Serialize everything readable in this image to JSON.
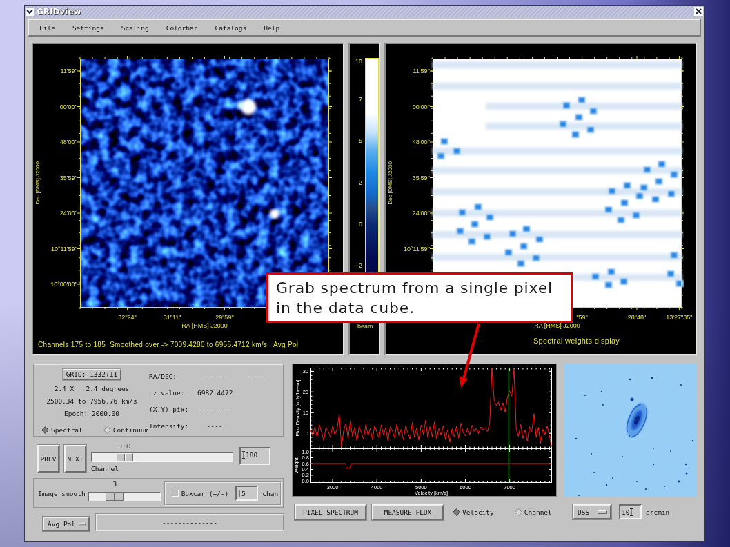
{
  "window": {
    "title": "GRIDview"
  },
  "menu": [
    "File",
    "Settings",
    "Scaling",
    "Colorbar",
    "Catalogs",
    "Help"
  ],
  "map_panel": {
    "dec_axis_title": "Dec [DMS] J2000",
    "dec_ticks": [
      "11'59''",
      "00'00''",
      "48'00''",
      "35'59''",
      "24'00''",
      "10°11'59''",
      "10°00'00''"
    ],
    "ra_ticks": [
      "32\"24\"",
      "31\"11\"",
      "29\"59\""
    ],
    "ra_axis_title": "RA [HMS] J2000",
    "caption": "Channels 175 to 185  Smoothed over -> 7009.4280 to 6955.4712 km/s   Avg Pol"
  },
  "colorbar": {
    "ticks": [
      "10",
      "7",
      "5",
      "2",
      "0",
      "−2"
    ],
    "unit": "beam"
  },
  "weights_panel": {
    "dec_axis_title": "Dec [DMS] J2000",
    "dec_ticks": [
      "11'59''",
      "00'00''",
      "48'00''",
      "35'59''",
      "24'00''",
      "10°11'59''"
    ],
    "ra_ticks": [
      "\"59\"",
      "28\"48\"",
      "13'27\"35\""
    ],
    "ra_axis_title": "RA [HMS] J2000",
    "caption": "Spectral weights display"
  },
  "callout": {
    "text": "Grab spectrum from a single pixel in the data cube."
  },
  "info": {
    "grid_label": "GRID: 1332+11",
    "size": "2.4 X   2.4 degrees",
    "velocity_range": "2500.34 to 7956.76 km/s",
    "epoch": "Epoch: 2000.00",
    "modes": [
      {
        "label": "Spectral",
        "selected": true
      },
      {
        "label": "Continuum",
        "selected": false
      }
    ],
    "readouts": [
      {
        "label": "RA/DEC:",
        "values": [
          "----",
          "----"
        ]
      },
      {
        "label": "cz value:",
        "values": [
          "6982.4472"
        ]
      },
      {
        "label": "(X,Y) pix:",
        "values": [
          "--------"
        ]
      },
      {
        "label": "Intensity:",
        "values": [
          "----"
        ]
      }
    ]
  },
  "channel": {
    "prev": "PREV",
    "next": "NEXT",
    "value_label": "180",
    "level": 0.2,
    "caption": "Channel",
    "input_value": "180"
  },
  "smooth": {
    "label": "Image smooth",
    "value_label": "3",
    "level": 0.32,
    "boxcar": {
      "label": "Boxcar (+/-)",
      "checked": false,
      "value": "5",
      "unit": "chan"
    }
  },
  "polarization": {
    "selection": "Avg Pol",
    "status": "--------------"
  },
  "spectrum": {
    "flux_chart": {
      "chart_data": {
        "type": "line",
        "ylabel": "Flux Density [mJy/beam]",
        "x": [
          2500,
          2550,
          2600,
          2650,
          2700,
          2750,
          2800,
          2850,
          2900,
          2950,
          3000,
          3050,
          3100,
          3150,
          3200,
          3250,
          3300,
          3350,
          3400,
          3450,
          3500,
          3550,
          3600,
          3650,
          3700,
          3750,
          3800,
          3850,
          3900,
          3950,
          4000,
          4050,
          4100,
          4150,
          4200,
          4250,
          4300,
          4350,
          4400,
          4450,
          4500,
          4550,
          4600,
          4650,
          4700,
          4750,
          4800,
          4850,
          4900,
          4950,
          5000,
          5050,
          5100,
          5150,
          5200,
          5250,
          5300,
          5350,
          5400,
          5450,
          5500,
          5550,
          5600,
          5650,
          5700,
          5750,
          5800,
          5850,
          5900,
          5950,
          6000,
          6050,
          6100,
          6150,
          6200,
          6250,
          6300,
          6350,
          6400,
          6450,
          6500,
          6550,
          6600,
          6650,
          6700,
          6750,
          6800,
          6850,
          6900,
          6950,
          7000,
          7050,
          7100,
          7150,
          7200,
          7250,
          7300,
          7350,
          7400,
          7450,
          7500,
          7550,
          7600,
          7650,
          7700,
          7750,
          7800,
          7850,
          7900,
          7950
        ],
        "series": [
          {
            "color": "#ff1a1a",
            "values": [
              1.5,
              -1.2,
              3.1,
              -2.0,
              4.2,
              0.5,
              -3.5,
              2.8,
              1.0,
              -1.8,
              3.6,
              -0.7,
              2.2,
              9.2,
              -6.5,
              1.4,
              4.8,
              -2.6,
              5.9,
              -1.5,
              2.9,
              -3.8,
              3.3,
              0.2,
              -2.9,
              4.5,
              -1.1,
              2.4,
              -3.2,
              3.8,
              0.6,
              -2.4,
              4.1,
              -0.9,
              2.7,
              -3.6,
              3.0,
              1.2,
              -2.2,
              4.6,
              -1.4,
              2.0,
              -3.0,
              3.5,
              0.3,
              -2.8,
              5.2,
              -1.9,
              2.6,
              -3.4,
              4.0,
              -0.5,
              6.2,
              -2.1,
              3.2,
              -1.6,
              5.5,
              -2.7,
              2.3,
              -0.8,
              3.7,
              -3.1,
              1.8,
              -4.3,
              2.1,
              -1.7,
              3.4,
              -2.3,
              4.9,
              0.4,
              -1.3,
              2.5,
              -0.6,
              3.9,
              0.9,
              2.4,
              -0.2,
              3.1,
              1.6,
              2.8,
              0.7,
              5.0,
              31.5,
              16.0,
              13.5,
              15.2,
              11.0,
              14.8,
              10.2,
              17.5,
              20.5,
              18.0,
              31.0,
              2.0,
              -1.5,
              4.3,
              -2.5,
              1.7,
              -3.9,
              3.2,
              0.8,
              9.5,
              -2.0,
              2.9,
              -4.8,
              1.9,
              -0.6,
              3.6,
              -1.2,
              -6.5
            ]
          }
        ],
        "xlim": [
          2500,
          7957
        ],
        "ylim": [
          -7.3,
          31.8
        ],
        "yticks": [
          0,
          10,
          20,
          30
        ],
        "ref_lines": [
          {
            "axis": "x",
            "value": 6982,
            "color": "#10c010"
          }
        ]
      }
    },
    "weight_chart": {
      "chart_data": {
        "type": "line",
        "xlabel": "Velocity [km/s]",
        "ylabel": "Weight",
        "x": [
          2500,
          3300,
          3310,
          3400,
          3410,
          7950
        ],
        "series": [
          {
            "color": "#ff1a1a",
            "values": [
              0.6,
              0.6,
              0.45,
              0.45,
              0.6,
              0.6
            ]
          }
        ],
        "xlim": [
          2500,
          7957
        ],
        "ylim": [
          -0.06,
          1.12
        ],
        "xticks": [
          3000,
          4000,
          5000,
          6000,
          7000
        ],
        "yticks": [
          {
            "value": 0,
            "label": "0.0"
          },
          {
            "value": 0.2,
            "label": "0.2"
          },
          {
            "value": 0.4,
            "label": "0.4"
          },
          {
            "value": 0.6,
            "label": "0.6"
          },
          {
            "value": 0.8,
            "label": "0.8"
          },
          {
            "value": 1,
            "label": "1.0"
          }
        ],
        "ref_lines": [
          {
            "axis": "x",
            "value": 6982,
            "color": "#10c010"
          }
        ]
      }
    },
    "buttons": [
      "PIXEL SPECTRUM",
      "MEASURE FLUX"
    ],
    "axis_modes": [
      {
        "label": "Velocity",
        "selected": true
      },
      {
        "label": "Channel",
        "selected": false
      }
    ]
  },
  "survey": {
    "source": "DSS",
    "size": "10",
    "unit": "arcmin"
  }
}
